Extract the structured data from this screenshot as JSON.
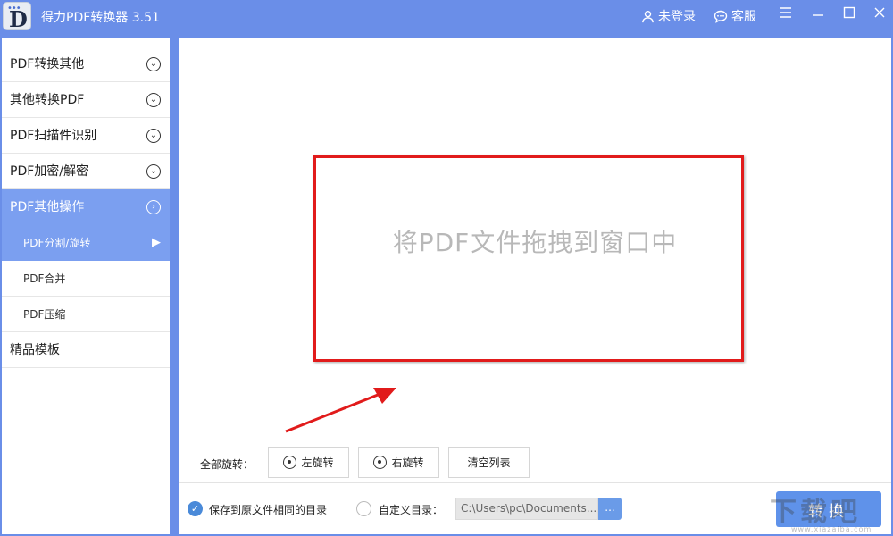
{
  "window": {
    "title": "得力PDF转换器 3.51",
    "logo_letter": "D",
    "login_label": "未登录",
    "service_label": "客服"
  },
  "sidebar": {
    "items": [
      {
        "label": "PDF转换其他",
        "expanded": false
      },
      {
        "label": "其他转换PDF",
        "expanded": false
      },
      {
        "label": "PDF扫描件识别",
        "expanded": false
      },
      {
        "label": "PDF加密/解密",
        "expanded": false
      },
      {
        "label": "PDF其他操作",
        "expanded": true,
        "active": true,
        "children": [
          {
            "label": "PDF分割/旋转",
            "active": true
          },
          {
            "label": "PDF合并"
          },
          {
            "label": "PDF压缩"
          }
        ]
      },
      {
        "label": "精品模板",
        "expanded": false
      }
    ]
  },
  "main": {
    "drop_hint": "将PDF文件拖拽到窗口中",
    "rotate": {
      "label": "全部旋转：",
      "rotate_left": "左旋转",
      "rotate_right": "右旋转",
      "clear_list": "清空列表"
    },
    "save": {
      "same_dir_label": "保存到原文件相同的目录",
      "custom_dir_label": "自定义目录：",
      "path_value": "C:\\Users\\pc\\Documents...",
      "browse_label": "...",
      "convert_label": "转换"
    }
  },
  "overlay": {
    "highlight_color": "#e11b1b",
    "watermark_text": "下载吧",
    "watermark_url": "www.xiazaiba.com"
  },
  "colors": {
    "accent": "#6a8ee8",
    "active_item": "#7b9ff0",
    "convert_button": "#5f92ea"
  }
}
